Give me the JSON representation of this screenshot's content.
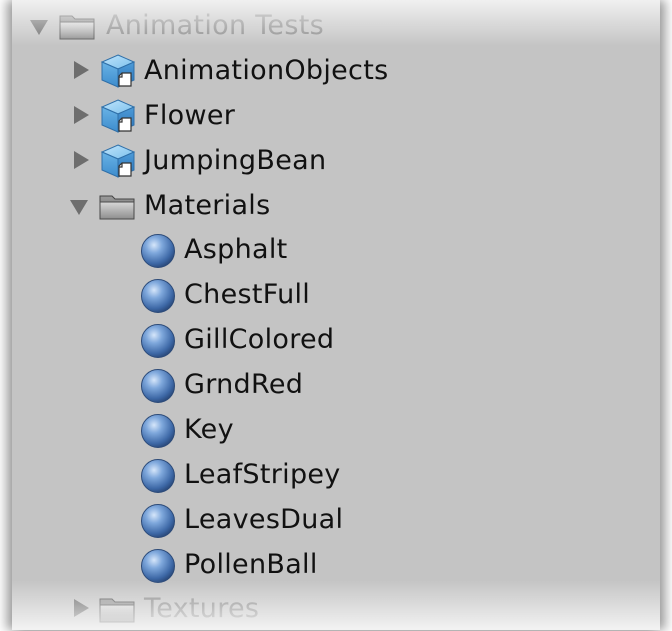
{
  "tree": {
    "root": {
      "label": "Animation Tests",
      "icon": "folder-icon",
      "expanded": true
    },
    "children": [
      {
        "label": "AnimationObjects",
        "icon": "prefab-cube-icon",
        "expanded": false
      },
      {
        "label": "Flower",
        "icon": "prefab-cube-icon",
        "expanded": false
      },
      {
        "label": "JumpingBean",
        "icon": "prefab-cube-icon",
        "expanded": false
      },
      {
        "label": "Materials",
        "icon": "folder-icon",
        "expanded": true
      },
      {
        "label": "Textures",
        "icon": "folder-icon",
        "expanded": false
      }
    ],
    "materials": [
      {
        "label": "Asphalt",
        "icon": "material-sphere-icon"
      },
      {
        "label": "ChestFull",
        "icon": "material-sphere-icon"
      },
      {
        "label": "GillColored",
        "icon": "material-sphere-icon"
      },
      {
        "label": "GrndRed",
        "icon": "material-sphere-icon"
      },
      {
        "label": "Key",
        "icon": "material-sphere-icon"
      },
      {
        "label": "LeafStripey",
        "icon": "material-sphere-icon"
      },
      {
        "label": "LeavesDual",
        "icon": "material-sphere-icon"
      },
      {
        "label": "PollenBall",
        "icon": "material-sphere-icon"
      }
    ]
  },
  "colors": {
    "panel_background": "#c4c4c4",
    "text": "#111111",
    "faded_text": "#8c8c8c",
    "prefab_blue": "#4a9ad6",
    "material_blue": "#4a78b8"
  }
}
